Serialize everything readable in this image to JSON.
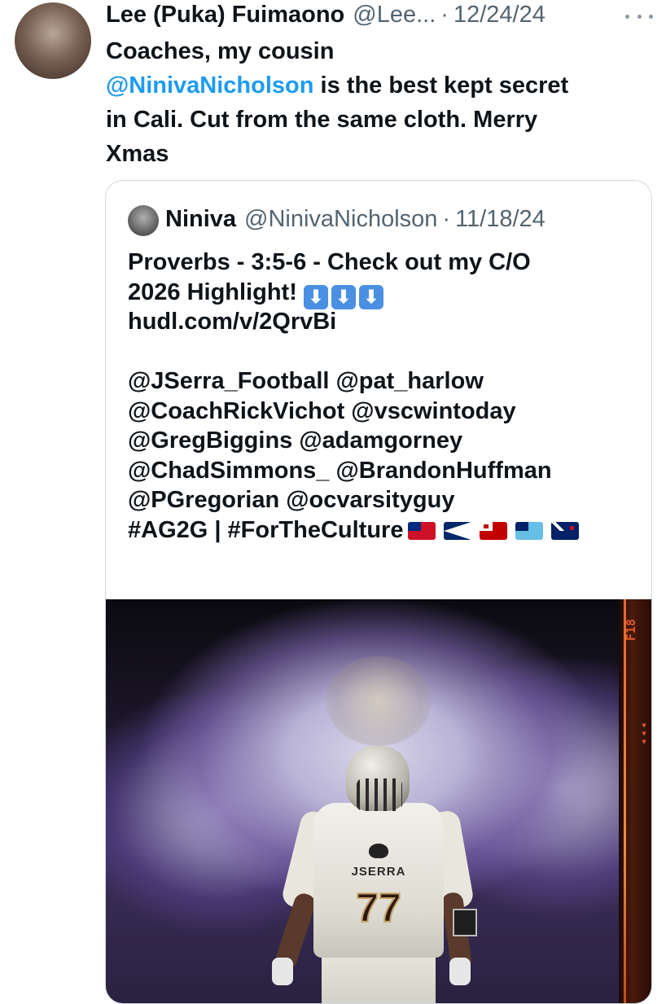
{
  "tweet": {
    "author_name": "Lee (Puka) Fuimaono",
    "author_handle": "@Lee...",
    "separator": "·",
    "date": "12/24/24",
    "text_line1": "Coaches, my cousin",
    "mention": "@NinivaNicholson",
    "text_line2_rest": " is the best kept secret",
    "text_line3": "in Cali. Cut from the same cloth. Merry",
    "text_line4": "Xmas"
  },
  "quoted_tweet": {
    "author_name": "Niniva",
    "author_handle": "@NinivaNicholson",
    "separator": "·",
    "date": "11/18/24",
    "lines": [
      "Proverbs - 3:5-6 - Check out my C/O",
      "2026 Highlight!",
      "hudl.com/v/2QrvBi",
      "",
      "@JSerra_Football @pat_harlow",
      "@CoachRickVichot @vscwintoday",
      "@GregBiggins @adamgorney",
      "@ChadSimmons_ @BrandonHuffman",
      "@PGregorian @ocvarsityguy",
      "#AG2G | #ForTheCulture"
    ],
    "arrow_glyph": "⬇",
    "flags": [
      "samoa-flag-icon",
      "american-samoa-flag-icon",
      "tonga-flag-icon",
      "fiji-flag-icon",
      "new-zealand-flag-icon"
    ]
  },
  "photo": {
    "jersey_school": "JSERRA",
    "jersey_number": "77",
    "film_marking": "F18"
  },
  "colors": {
    "text_primary": "#0f1419",
    "text_secondary": "#536471",
    "link": "#1d9bf0",
    "border": "#cfd9de"
  }
}
